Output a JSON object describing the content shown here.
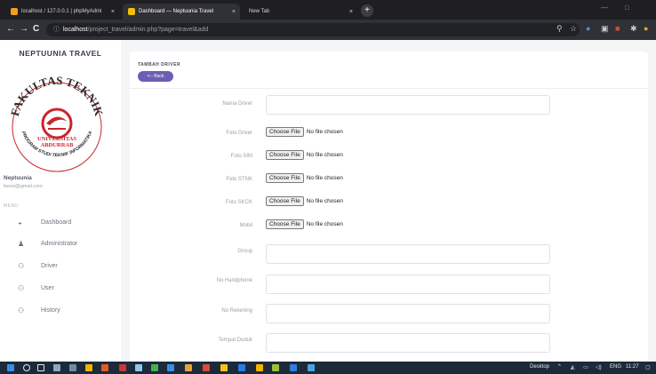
{
  "browser": {
    "tabs": [
      {
        "label": "localhost / 127.0.0.1 | phpMyAdmi",
        "active": false
      },
      {
        "label": "Dashboard — Neptuunia Travel",
        "active": true
      },
      {
        "label": "New Tab",
        "active": false
      }
    ],
    "tab_close": "×",
    "new_tab": "+",
    "window_minimize": "—",
    "window_maximize": "□",
    "url": {
      "host": "localhost",
      "path": "/project_travel/admin.php?page=travel&add"
    },
    "nav": {
      "back": "←",
      "forward": "→",
      "reload": "C"
    }
  },
  "sidebar": {
    "brand": "NEPTUUNIA TRAVEL",
    "logo": {
      "ring_top": "FAKULTAS TEKNIK",
      "ring_bottom": "PROGRAM STUDI TEKNIK INFORMATIKA",
      "center_line1": "UNIVERSITAS",
      "center_line2": "ABDURRAB",
      "colors": {
        "red": "#c8262e",
        "dark": "#2b2b2b"
      }
    },
    "user": {
      "name": "Neptuunia",
      "email": "hensi@gmail.com"
    },
    "menu_title": "MENU",
    "items": [
      {
        "label": "Dashboard",
        "icon": "dashboard-icon",
        "glyph": "◒"
      },
      {
        "label": "Administrator",
        "icon": "person-icon",
        "glyph": "♟"
      },
      {
        "label": "Driver",
        "icon": "group-icon",
        "glyph": "⚇"
      },
      {
        "label": "User",
        "icon": "group-icon",
        "glyph": "⚇"
      },
      {
        "label": "History",
        "icon": "group-icon",
        "glyph": "⚇"
      }
    ]
  },
  "main": {
    "title": "TAMBAH DRIVER",
    "back_button": "<-- Back",
    "fields": [
      {
        "label": "Nama Driver",
        "type": "text",
        "value": ""
      },
      {
        "label": "Foto Driver",
        "type": "file",
        "button": "Choose File",
        "status": "No file chosen"
      },
      {
        "label": "Foto SIM",
        "type": "file",
        "button": "Choose File",
        "status": "No file chosen"
      },
      {
        "label": "Foto STNK",
        "type": "file",
        "button": "Choose File",
        "status": "No file chosen"
      },
      {
        "label": "Foto SKCK",
        "type": "file",
        "button": "Choose File",
        "status": "No file chosen"
      },
      {
        "label": "Mobil",
        "type": "file",
        "button": "Choose File",
        "status": "No file chosen"
      },
      {
        "label": "Group",
        "type": "text",
        "value": ""
      },
      {
        "label": "No Handphone",
        "type": "text",
        "value": ""
      },
      {
        "label": "No Rekening",
        "type": "text",
        "value": ""
      },
      {
        "label": "Tempat Duduk",
        "type": "text",
        "value": ""
      }
    ]
  },
  "taskbar": {
    "desktop_label": "Desktop",
    "language": "ENG",
    "time": "11:27"
  },
  "colors": {
    "accent": "#6b5fb5",
    "chrome_dark": "#1f1f23",
    "taskbar": "#1c2a3a"
  }
}
